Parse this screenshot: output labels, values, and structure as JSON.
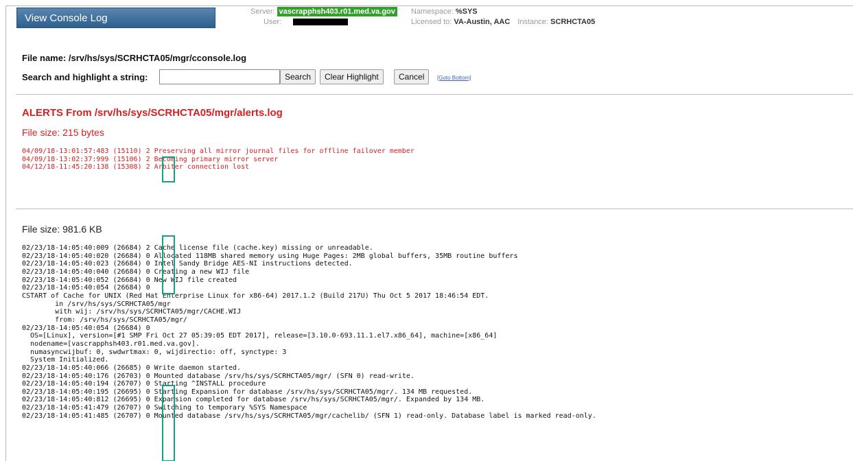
{
  "header": {
    "title": "View Console Log",
    "server_label": "Server:",
    "server_value": "vascrapphsh403.r01.med.va.gov",
    "user_label": "User:",
    "namespace_label": "Namespace:",
    "namespace_value": "%SYS",
    "licensed_label": "Licensed to:",
    "licensed_value": "VA-Austin, AAC",
    "instance_label": "Instance:",
    "instance_value": "SCRHCTA05"
  },
  "file_name": "File name: /srv/hs/sys/SCRHCTA05/mgr/cconsole.log",
  "search": {
    "label": "Search and highlight a string:",
    "value": "",
    "search_button": "Search",
    "clear_button": "Clear Highlight",
    "cancel_button": "Cancel",
    "goto_bottom": "[Goto Bottom]"
  },
  "alerts": {
    "title": "ALERTS From /srv/hs/sys/SCRHCTA05/mgr/alerts.log",
    "file_size": "File size: 215 bytes",
    "log_text": "04/09/18-13:01:57:483 (15110) 2 Preserving all mirror journal files for offline failover member\n04/09/18-13:02:37:999 (15106) 2 Becoming primary mirror server\n04/12/18-11:45:20:138 (15308) 2 Arbiter connection lost"
  },
  "console": {
    "file_size": "File size: 981.6 KB",
    "log_text": "02/23/18-14:05:40:009 (26684) 2 Cache license file (cache.key) missing or unreadable.\n02/23/18-14:05:40:020 (26684) 0 Allocated 118MB shared memory using Huge Pages: 2MB global buffers, 35MB routine buffers\n02/23/18-14:05:40:023 (26684) 0 Intel Sandy Bridge AES-NI instructions detected.\n02/23/18-14:05:40:040 (26684) 0 Creating a new WIJ file\n02/23/18-14:05:40:052 (26684) 0 New WIJ file created\n02/23/18-14:05:40:054 (26684) 0\nCSTART of Cache for UNIX (Red Hat Enterprise Linux for x86-64) 2017.1.2 (Build 217U) Thu Oct 5 2017 18:46:54 EDT.\n        in /srv/hs/sys/SCRHCTA05/mgr\n        with wij: /srv/hs/sys/SCRHCTA05/mgr/CACHE.WIJ\n        from: /srv/hs/sys/SCRHCTA05/mgr/\n02/23/18-14:05:40:054 (26684) 0\n  OS=[Linux], version=[#1 SMP Fri Oct 27 05:39:05 EDT 2017], release=[3.10.0-693.11.1.el7.x86_64], machine=[x86_64]\n  nodename=[vascrapphsh403.r01.med.va.gov].\n  numasyncwijbuf: 0, swdwrtmax: 0, wijdirectio: off, synctype: 3\n  System Initialized.\n02/23/18-14:05:40:066 (26685) 0 Write daemon started.\n02/23/18-14:05:40:176 (26703) 0 Mounted database /srv/hs/sys/SCRHCTA05/mgr/ (SFN 0) read-write.\n02/23/18-14:05:40:194 (26707) 0 Starting ^INSTALL procedure\n02/23/18-14:05:40:195 (26695) 0 Starting Expansion for database /srv/hs/sys/SCRHCTA05/mgr/. 134 MB requested.\n02/23/18-14:05:40:812 (26695) 0 Expansion completed for database /srv/hs/sys/SCRHCTA05/mgr/. Expanded by 134 MB.\n02/23/18-14:05:41:479 (26707) 0 Switching to temporary %SYS Namespace\n02/23/18-14:05:41:485 (26707) 0 Mounted database /srv/hs/sys/SCRHCTA05/mgr/cachelib/ (SFN 1) read-only. Database label is marked read-only."
  },
  "colors": {
    "accent_blue": "#2e5f8e",
    "server_green": "#33a02c",
    "alert_red": "#d42020",
    "highlight_teal": "#16a085"
  }
}
